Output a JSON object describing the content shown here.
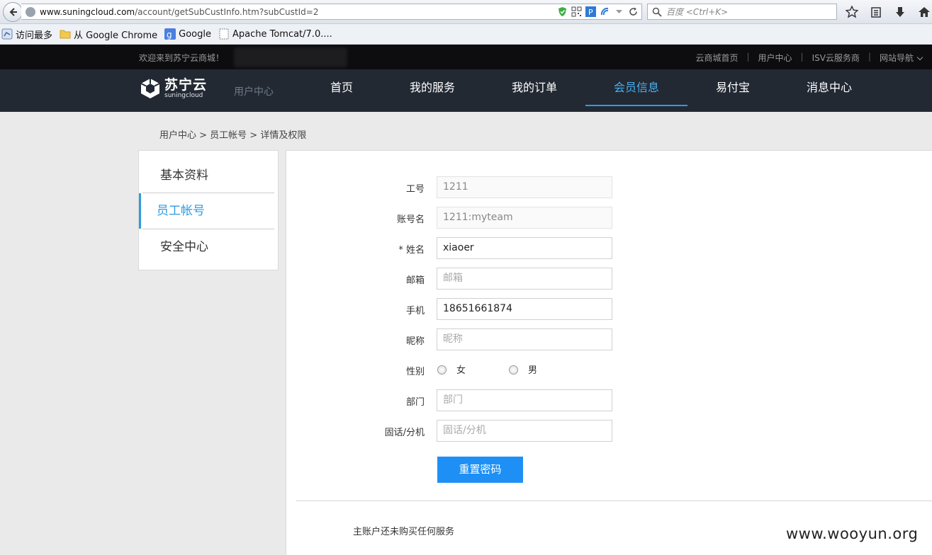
{
  "browser": {
    "url_host": "www.suningcloud.com",
    "url_path": "/account/getSubCustInfo.htm?subCustId=2",
    "search_placeholder": "百度 <Ctrl+K>",
    "bookmarks": [
      "访问最多",
      "从 Google Chrome",
      "Google",
      "Apache Tomcat/7.0...."
    ]
  },
  "topbar": {
    "welcome": "欢迎来到苏宁云商城！",
    "links": [
      "云商城首页",
      "用户中心",
      "ISV云服务商",
      "网站导航"
    ]
  },
  "nav": {
    "logo_cn": "苏宁云",
    "logo_en": "suningcloud",
    "section": "用户中心",
    "items": [
      "首页",
      "我的服务",
      "我的订单",
      "会员信息",
      "易付宝",
      "消息中心"
    ],
    "active_item": "会员信息"
  },
  "breadcrumb": "用户中心 > 员工帐号 > 详情及权限",
  "sidebar": {
    "items": [
      "基本资料",
      "员工帐号",
      "安全中心"
    ],
    "active_item": "员工帐号"
  },
  "form": {
    "emp_no": {
      "label": "工号",
      "value": "1211"
    },
    "account": {
      "label": "账号名",
      "value": "1211:myteam"
    },
    "name": {
      "label": "* 姓名",
      "value": "xiaoer"
    },
    "email": {
      "label": "邮箱",
      "placeholder": "邮箱"
    },
    "phone": {
      "label": "手机",
      "value": "18651661874"
    },
    "nickname": {
      "label": "昵称",
      "placeholder": "昵称"
    },
    "gender": {
      "label": "性别",
      "options": [
        "女",
        "男"
      ]
    },
    "dept": {
      "label": "部门",
      "placeholder": "部门"
    },
    "tel": {
      "label": "固话/分机",
      "placeholder": "固话/分机"
    },
    "reset_button": "重置密码"
  },
  "note": "主账户还未购买任何服务",
  "watermark": "www.wooyun.org",
  "colors": {
    "accent": "#2f9be0",
    "nav_bg": "#222933",
    "topbar_bg": "#0d0d0f",
    "button": "#1e90f5"
  }
}
